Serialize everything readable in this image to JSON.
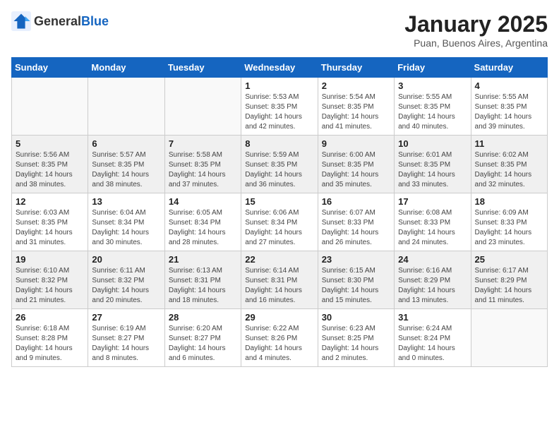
{
  "header": {
    "logo_general": "General",
    "logo_blue": "Blue",
    "month": "January 2025",
    "location": "Puan, Buenos Aires, Argentina"
  },
  "weekdays": [
    "Sunday",
    "Monday",
    "Tuesday",
    "Wednesday",
    "Thursday",
    "Friday",
    "Saturday"
  ],
  "weeks": [
    [
      {
        "day": "",
        "info": ""
      },
      {
        "day": "",
        "info": ""
      },
      {
        "day": "",
        "info": ""
      },
      {
        "day": "1",
        "info": "Sunrise: 5:53 AM\nSunset: 8:35 PM\nDaylight: 14 hours\nand 42 minutes."
      },
      {
        "day": "2",
        "info": "Sunrise: 5:54 AM\nSunset: 8:35 PM\nDaylight: 14 hours\nand 41 minutes."
      },
      {
        "day": "3",
        "info": "Sunrise: 5:55 AM\nSunset: 8:35 PM\nDaylight: 14 hours\nand 40 minutes."
      },
      {
        "day": "4",
        "info": "Sunrise: 5:55 AM\nSunset: 8:35 PM\nDaylight: 14 hours\nand 39 minutes."
      }
    ],
    [
      {
        "day": "5",
        "info": "Sunrise: 5:56 AM\nSunset: 8:35 PM\nDaylight: 14 hours\nand 38 minutes."
      },
      {
        "day": "6",
        "info": "Sunrise: 5:57 AM\nSunset: 8:35 PM\nDaylight: 14 hours\nand 38 minutes."
      },
      {
        "day": "7",
        "info": "Sunrise: 5:58 AM\nSunset: 8:35 PM\nDaylight: 14 hours\nand 37 minutes."
      },
      {
        "day": "8",
        "info": "Sunrise: 5:59 AM\nSunset: 8:35 PM\nDaylight: 14 hours\nand 36 minutes."
      },
      {
        "day": "9",
        "info": "Sunrise: 6:00 AM\nSunset: 8:35 PM\nDaylight: 14 hours\nand 35 minutes."
      },
      {
        "day": "10",
        "info": "Sunrise: 6:01 AM\nSunset: 8:35 PM\nDaylight: 14 hours\nand 33 minutes."
      },
      {
        "day": "11",
        "info": "Sunrise: 6:02 AM\nSunset: 8:35 PM\nDaylight: 14 hours\nand 32 minutes."
      }
    ],
    [
      {
        "day": "12",
        "info": "Sunrise: 6:03 AM\nSunset: 8:35 PM\nDaylight: 14 hours\nand 31 minutes."
      },
      {
        "day": "13",
        "info": "Sunrise: 6:04 AM\nSunset: 8:34 PM\nDaylight: 14 hours\nand 30 minutes."
      },
      {
        "day": "14",
        "info": "Sunrise: 6:05 AM\nSunset: 8:34 PM\nDaylight: 14 hours\nand 28 minutes."
      },
      {
        "day": "15",
        "info": "Sunrise: 6:06 AM\nSunset: 8:34 PM\nDaylight: 14 hours\nand 27 minutes."
      },
      {
        "day": "16",
        "info": "Sunrise: 6:07 AM\nSunset: 8:33 PM\nDaylight: 14 hours\nand 26 minutes."
      },
      {
        "day": "17",
        "info": "Sunrise: 6:08 AM\nSunset: 8:33 PM\nDaylight: 14 hours\nand 24 minutes."
      },
      {
        "day": "18",
        "info": "Sunrise: 6:09 AM\nSunset: 8:33 PM\nDaylight: 14 hours\nand 23 minutes."
      }
    ],
    [
      {
        "day": "19",
        "info": "Sunrise: 6:10 AM\nSunset: 8:32 PM\nDaylight: 14 hours\nand 21 minutes."
      },
      {
        "day": "20",
        "info": "Sunrise: 6:11 AM\nSunset: 8:32 PM\nDaylight: 14 hours\nand 20 minutes."
      },
      {
        "day": "21",
        "info": "Sunrise: 6:13 AM\nSunset: 8:31 PM\nDaylight: 14 hours\nand 18 minutes."
      },
      {
        "day": "22",
        "info": "Sunrise: 6:14 AM\nSunset: 8:31 PM\nDaylight: 14 hours\nand 16 minutes."
      },
      {
        "day": "23",
        "info": "Sunrise: 6:15 AM\nSunset: 8:30 PM\nDaylight: 14 hours\nand 15 minutes."
      },
      {
        "day": "24",
        "info": "Sunrise: 6:16 AM\nSunset: 8:29 PM\nDaylight: 14 hours\nand 13 minutes."
      },
      {
        "day": "25",
        "info": "Sunrise: 6:17 AM\nSunset: 8:29 PM\nDaylight: 14 hours\nand 11 minutes."
      }
    ],
    [
      {
        "day": "26",
        "info": "Sunrise: 6:18 AM\nSunset: 8:28 PM\nDaylight: 14 hours\nand 9 minutes."
      },
      {
        "day": "27",
        "info": "Sunrise: 6:19 AM\nSunset: 8:27 PM\nDaylight: 14 hours\nand 8 minutes."
      },
      {
        "day": "28",
        "info": "Sunrise: 6:20 AM\nSunset: 8:27 PM\nDaylight: 14 hours\nand 6 minutes."
      },
      {
        "day": "29",
        "info": "Sunrise: 6:22 AM\nSunset: 8:26 PM\nDaylight: 14 hours\nand 4 minutes."
      },
      {
        "day": "30",
        "info": "Sunrise: 6:23 AM\nSunset: 8:25 PM\nDaylight: 14 hours\nand 2 minutes."
      },
      {
        "day": "31",
        "info": "Sunrise: 6:24 AM\nSunset: 8:24 PM\nDaylight: 14 hours\nand 0 minutes."
      },
      {
        "day": "",
        "info": ""
      }
    ]
  ]
}
